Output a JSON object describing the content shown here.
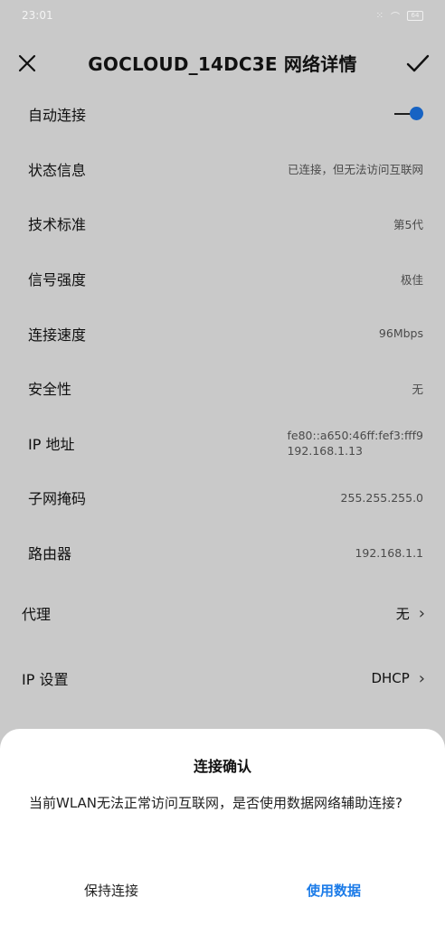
{
  "status_bar": {
    "time": "23:01",
    "signal_text": "⁙",
    "wifi_text": "⌒",
    "battery_level": "64"
  },
  "header": {
    "title": "GOCLOUD_14DC3E 网络详情"
  },
  "details": {
    "auto_connect_label": "自动连接",
    "auto_connect_on": true,
    "rows": [
      {
        "label": "状态信息",
        "value": "已连接，但无法访问互联网"
      },
      {
        "label": "技术标准",
        "value": "第5代"
      },
      {
        "label": "信号强度",
        "value": "极佳"
      },
      {
        "label": "连接速度",
        "value": "96Mbps"
      },
      {
        "label": "安全性",
        "value": "无"
      },
      {
        "label": "IP 地址",
        "value": "fe80::a650:46ff:fef3:fff9",
        "value2": "192.168.1.13"
      },
      {
        "label": "子网掩码",
        "value": "255.255.255.0"
      },
      {
        "label": "路由器",
        "value": "192.168.1.1"
      }
    ]
  },
  "proxy": {
    "label": "代理",
    "value": "无"
  },
  "ip_settings": {
    "label": "IP 设置",
    "value": "DHCP"
  },
  "dialog": {
    "title": "连接确认",
    "message": "当前WLAN无法正常访问互联网，是否使用数据网络辅助连接?",
    "keep_button": "保持连接",
    "use_data_button": "使用数据",
    "accent": "#1b7be8"
  },
  "colors": {
    "toggle_on": "#1763c3"
  }
}
